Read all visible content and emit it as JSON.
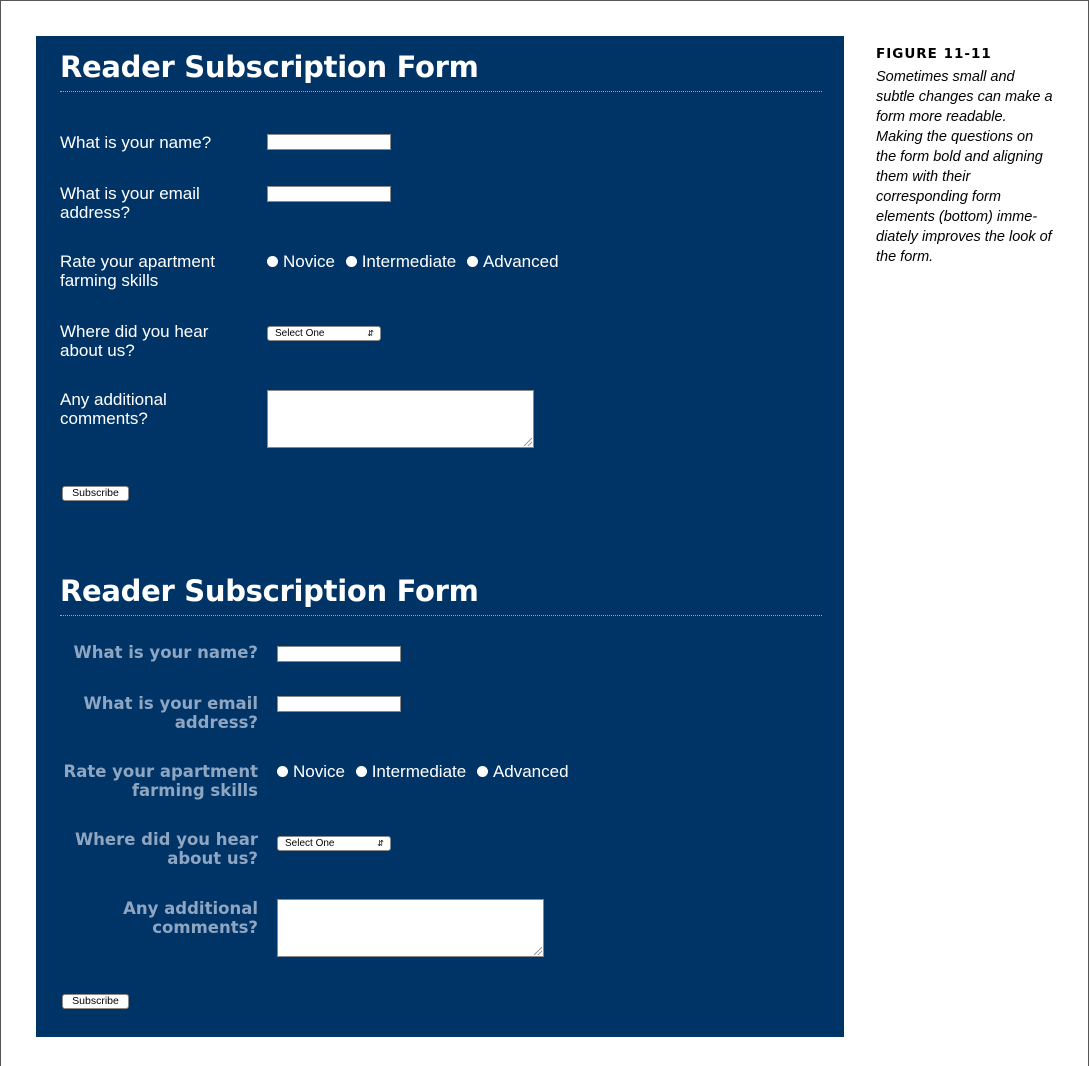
{
  "figure": {
    "label": "FIGURE 11-11",
    "caption": "Sometimes small and subtle changes can make a form more readable. Making the questions on the form bold and aligning them with their corresponding form elements (bottom) imme-diately improves the look of the form."
  },
  "forms": [
    {
      "title": "Reader Subscription Form",
      "q_name": "What is your name?",
      "q_email": "What is your email address?",
      "q_rate": "Rate your apartment farming skills",
      "q_where": "Where did you hear about us?",
      "q_comments": "Any additional comments?",
      "radio_options": [
        "Novice",
        "Intermediate",
        "Advanced"
      ],
      "select_value": "Select One",
      "button_label": "Subscribe"
    },
    {
      "title": "Reader Subscription Form",
      "q_name": "What is your name?",
      "q_email": "What is your email address?",
      "q_rate": "Rate your apartment farming skills",
      "q_where": "Where did you hear about us?",
      "q_comments": "Any additional comments?",
      "radio_options": [
        "Novice",
        "Intermediate",
        "Advanced"
      ],
      "select_value": "Select One",
      "button_label": "Subscribe"
    }
  ],
  "colors": {
    "panel_background": "#003366",
    "bold_label": "#8fa6c2"
  }
}
